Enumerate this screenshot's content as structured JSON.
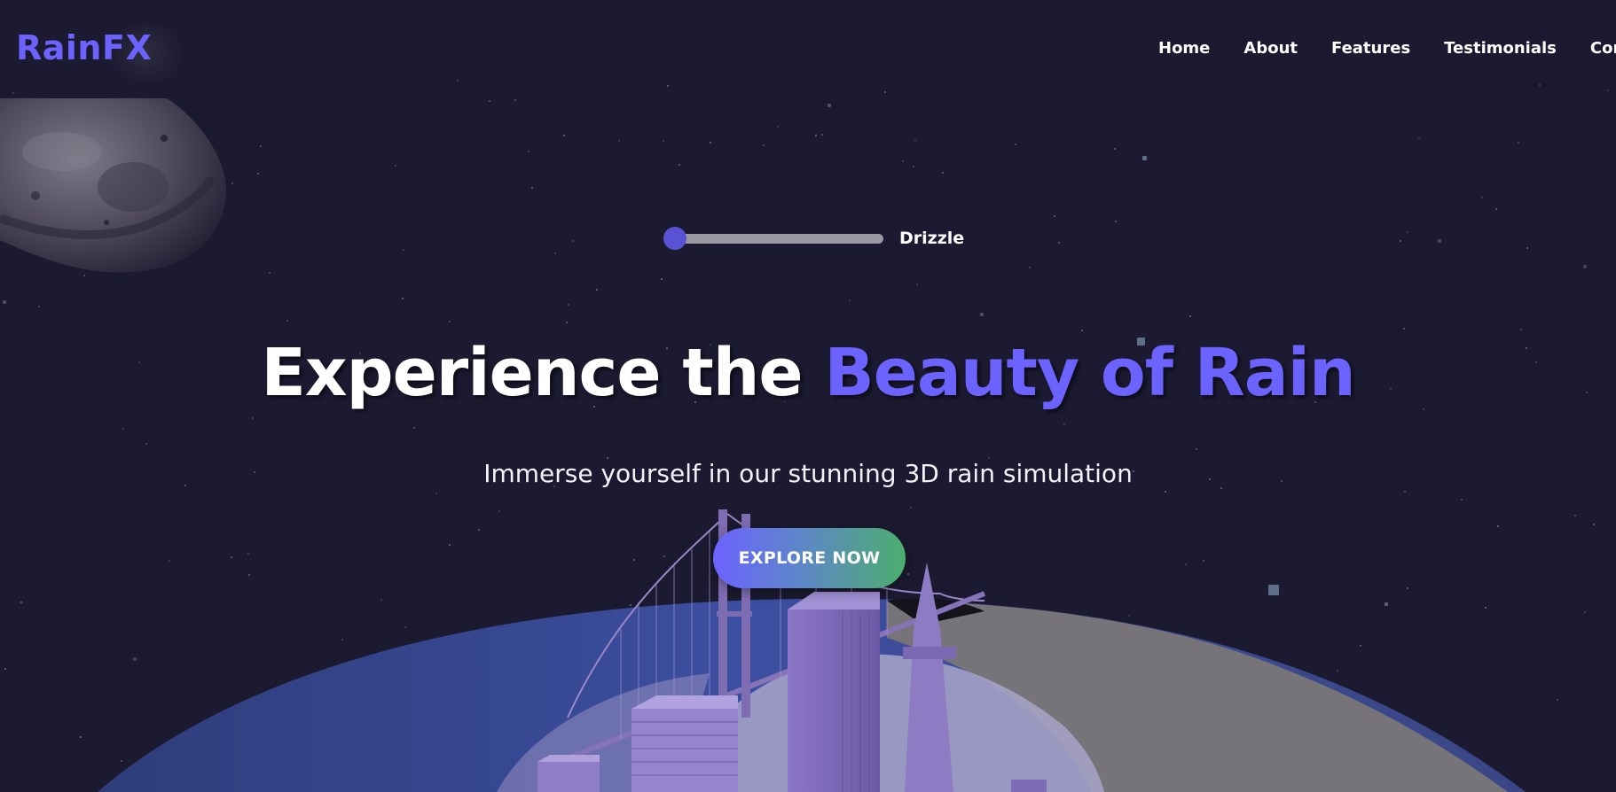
{
  "brand": {
    "name": "RainFX",
    "accent_color": "#6c63ff"
  },
  "nav": {
    "links": [
      {
        "label": "Home"
      },
      {
        "label": "About"
      },
      {
        "label": "Features"
      },
      {
        "label": "Testimonials"
      },
      {
        "label": "Conta"
      }
    ]
  },
  "rain_control": {
    "intensity_label": "Drizzle",
    "level": 0
  },
  "hero": {
    "title_main": "Experience the",
    "title_accent": "Beauty of Rain",
    "subtitle": "Immerse yourself in our stunning 3D rain simulation",
    "cta_label": "EXPLORE NOW"
  },
  "colors": {
    "background": "#1b1a30",
    "cta_gradient_start": "#6c63ff",
    "cta_gradient_end": "#4cae6e",
    "slider_thumb": "#5a52d4",
    "slider_track": "#9a98a3"
  }
}
